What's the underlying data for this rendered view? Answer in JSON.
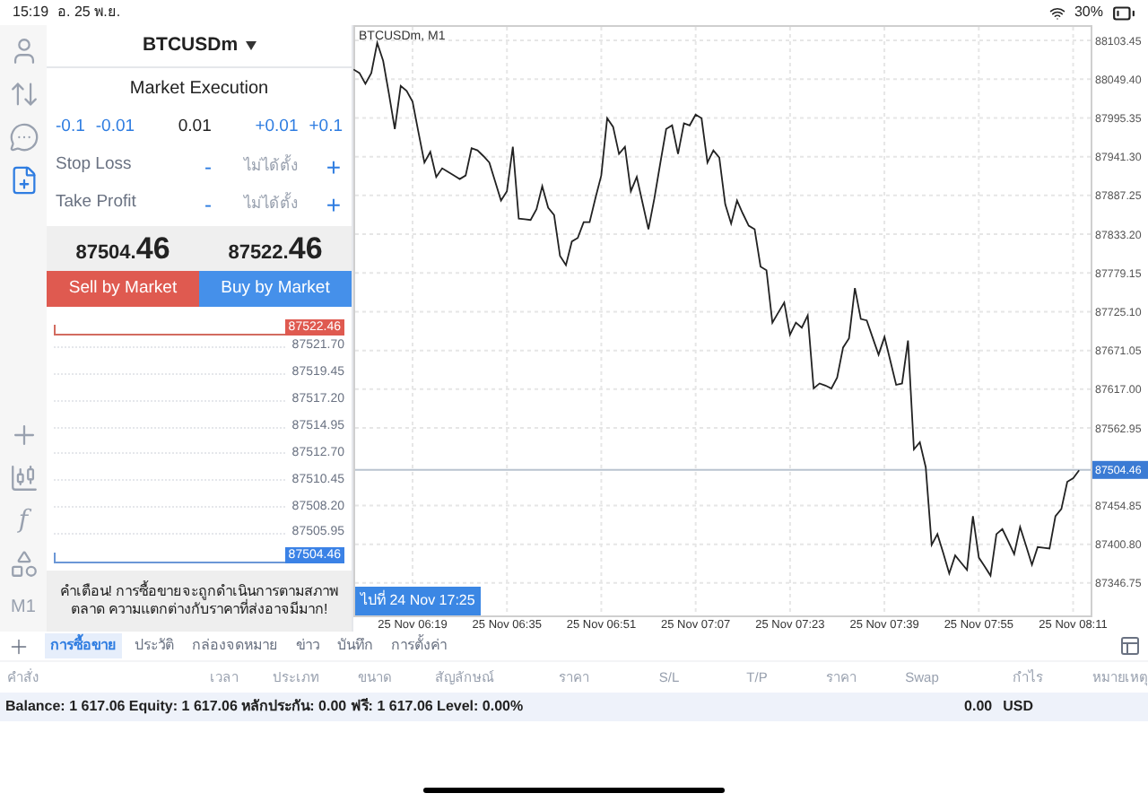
{
  "status_bar": {
    "time": "15:19",
    "date": "อ. 25 พ.ย.",
    "battery": "30%"
  },
  "sidebar": {
    "top": [
      {
        "kind": "account",
        "selected": false
      },
      {
        "kind": "trade",
        "selected": false
      },
      {
        "kind": "chat",
        "selected": false
      },
      {
        "kind": "new-order",
        "selected": true
      }
    ],
    "tools": [
      {
        "kind": "crosshair"
      },
      {
        "kind": "candles"
      },
      {
        "kind": "glyph",
        "text": "f"
      },
      {
        "kind": "objects"
      },
      {
        "kind": "glyph",
        "text": "M1"
      }
    ]
  },
  "order_panel": {
    "symbol": "BTCUSDm",
    "execution": "Market Execution",
    "volume_down": [
      "-0.1",
      "-0.01"
    ],
    "volume": "0.01",
    "volume_up": [
      "+0.01",
      "+0.1"
    ],
    "levels": [
      {
        "label": "Stop Loss",
        "minus": "-",
        "value": "ไม่ได้ตั้ง",
        "plus": "+"
      },
      {
        "label": "Take Profit",
        "minus": "-",
        "value": "ไม่ได้ตั้ง",
        "plus": "+"
      }
    ],
    "bid": {
      "main": "87504.",
      "big": "46"
    },
    "ask": {
      "main": "87522.",
      "big": "46"
    },
    "sell_button": "Sell by Market",
    "buy_button": "Buy by Market",
    "ask_tag": "87522.46",
    "price_labels": [
      "87521.70",
      "87519.45",
      "87517.20",
      "87514.95",
      "87512.70",
      "87510.45",
      "87508.20",
      "87505.95"
    ],
    "bid_tag": "87504.46",
    "warning": "คำเตือน! การซื้อขายจะถูกดำเนินการตามสภาพตลาด ความแตกต่างกับราคาที่ส่งอาจมีมาก!"
  },
  "chart": {
    "chart_data": {
      "type": "line",
      "title": "BTCUSDm, M1",
      "categories": [
        null,
        null,
        null,
        null,
        null,
        null,
        null,
        null,
        null,
        null,
        "25 Nov 06:19",
        null,
        null,
        null,
        null,
        null,
        null,
        null,
        null,
        null,
        null,
        null,
        null,
        null,
        null,
        null,
        "25 Nov 06:35",
        null,
        null,
        null,
        null,
        null,
        null,
        null,
        null,
        null,
        null,
        null,
        null,
        null,
        null,
        null,
        "25 Nov 06:51",
        null,
        null,
        null,
        null,
        null,
        null,
        null,
        null,
        null,
        null,
        null,
        null,
        null,
        null,
        null,
        "25 Nov 07:07",
        null,
        null,
        null,
        null,
        null,
        null,
        null,
        null,
        null,
        null,
        null,
        null,
        null,
        null,
        null,
        "25 Nov 07:23",
        null,
        null,
        null,
        null,
        null,
        null,
        null,
        null,
        null,
        null,
        null,
        null,
        null,
        null,
        null,
        "25 Nov 07:39",
        null,
        null,
        null,
        null,
        null,
        null,
        null,
        null,
        null,
        null,
        null,
        null,
        null,
        null,
        null,
        "25 Nov 07:55",
        null,
        null,
        null,
        null,
        null,
        null,
        null,
        null,
        null,
        null,
        null,
        null,
        null,
        null,
        null,
        "25 Nov 08:11",
        null
      ],
      "series": [
        {
          "color": "#222222",
          "values": [
            88063,
            88058,
            88043,
            88058,
            88100,
            88075,
            88028,
            87980,
            88040,
            88033,
            88018,
            87975,
            87933,
            87948,
            87913,
            87925,
            87920,
            87915,
            87910,
            87915,
            87953,
            87950,
            87942,
            87933,
            87907,
            87880,
            87893,
            87955,
            87855,
            87854,
            87853,
            87868,
            87900,
            87870,
            87860,
            87803,
            87790,
            87823,
            87828,
            87850,
            87850,
            87883,
            87915,
            87995,
            87983,
            87945,
            87955,
            87893,
            87913,
            87877,
            87840,
            87883,
            87932,
            87980,
            87985,
            87945,
            87988,
            87985,
            88000,
            87995,
            87933,
            87950,
            87940,
            87875,
            87848,
            87880,
            87862,
            87845,
            87840,
            87788,
            87783,
            87710,
            87724,
            87738,
            87693,
            87710,
            87703,
            87720,
            87618,
            87625,
            87622,
            87618,
            87633,
            87675,
            87688,
            87758,
            87715,
            87713,
            87689,
            87665,
            87690,
            87657,
            87623,
            87625,
            87685,
            87533,
            87543,
            87508,
            87400,
            87415,
            87388,
            87360,
            87385,
            87375,
            87365,
            87440,
            87382,
            87370,
            87357,
            87415,
            87422,
            87405,
            87387,
            87425,
            87399,
            87372,
            87397,
            87396,
            87395,
            87440,
            87450,
            87488,
            87493,
            87504
          ]
        }
      ],
      "grid": true,
      "ref_lines": [
        {
          "axis": "y",
          "value": 87504.46,
          "label": "87504.46"
        }
      ],
      "ylim": [
        87300.3,
        88123.5
      ],
      "yticks": [
        {
          "value": 88103.45,
          "label": "88103.45"
        },
        {
          "value": 88049.4,
          "label": "88049.40"
        },
        {
          "value": 87995.35,
          "label": "87995.35"
        },
        {
          "value": 87941.3,
          "label": "87941.30"
        },
        {
          "value": 87887.25,
          "label": "87887.25"
        },
        {
          "value": 87833.2,
          "label": "87833.20"
        },
        {
          "value": 87779.15,
          "label": "87779.15"
        },
        {
          "value": 87725.1,
          "label": "87725.10"
        },
        {
          "value": 87671.05,
          "label": "87671.05"
        },
        {
          "value": 87617,
          "label": "87617.00"
        },
        {
          "value": 87562.95,
          "label": "87562.95"
        },
        {
          "value": 87454.85,
          "label": "87454.85"
        },
        {
          "value": 87400.8,
          "label": "87400.80"
        },
        {
          "value": 87346.75,
          "label": "87346.75"
        }
      ]
    },
    "goto_button": "ไปที่ 24 Nov 17:25"
  },
  "bottom_tabs": [
    {
      "label": "การซื้อขาย",
      "selected": true
    },
    {
      "label": "ประวัติ",
      "selected": false
    },
    {
      "label": "กล่องจดหมาย",
      "selected": false
    },
    {
      "label": "ข่าว",
      "selected": false
    },
    {
      "label": "บันทึก",
      "selected": false
    },
    {
      "label": "การตั้งค่า",
      "selected": false
    }
  ],
  "columns": [
    "คำสั่ง",
    "เวลา",
    "ประเภท",
    "ขนาด",
    "สัญลักษณ์",
    "ราคา",
    "S/L",
    "T/P",
    "ราคา",
    "Swap",
    "กำไร",
    "หมายเหตุ"
  ],
  "balance_row": {
    "summary": "Balance: 1 617.06 Equity: 1 617.06 หลักประกัน: 0.00 ฟรี: 1 617.06 Level: 0.00%",
    "profit": "0.00",
    "currency": "USD"
  }
}
